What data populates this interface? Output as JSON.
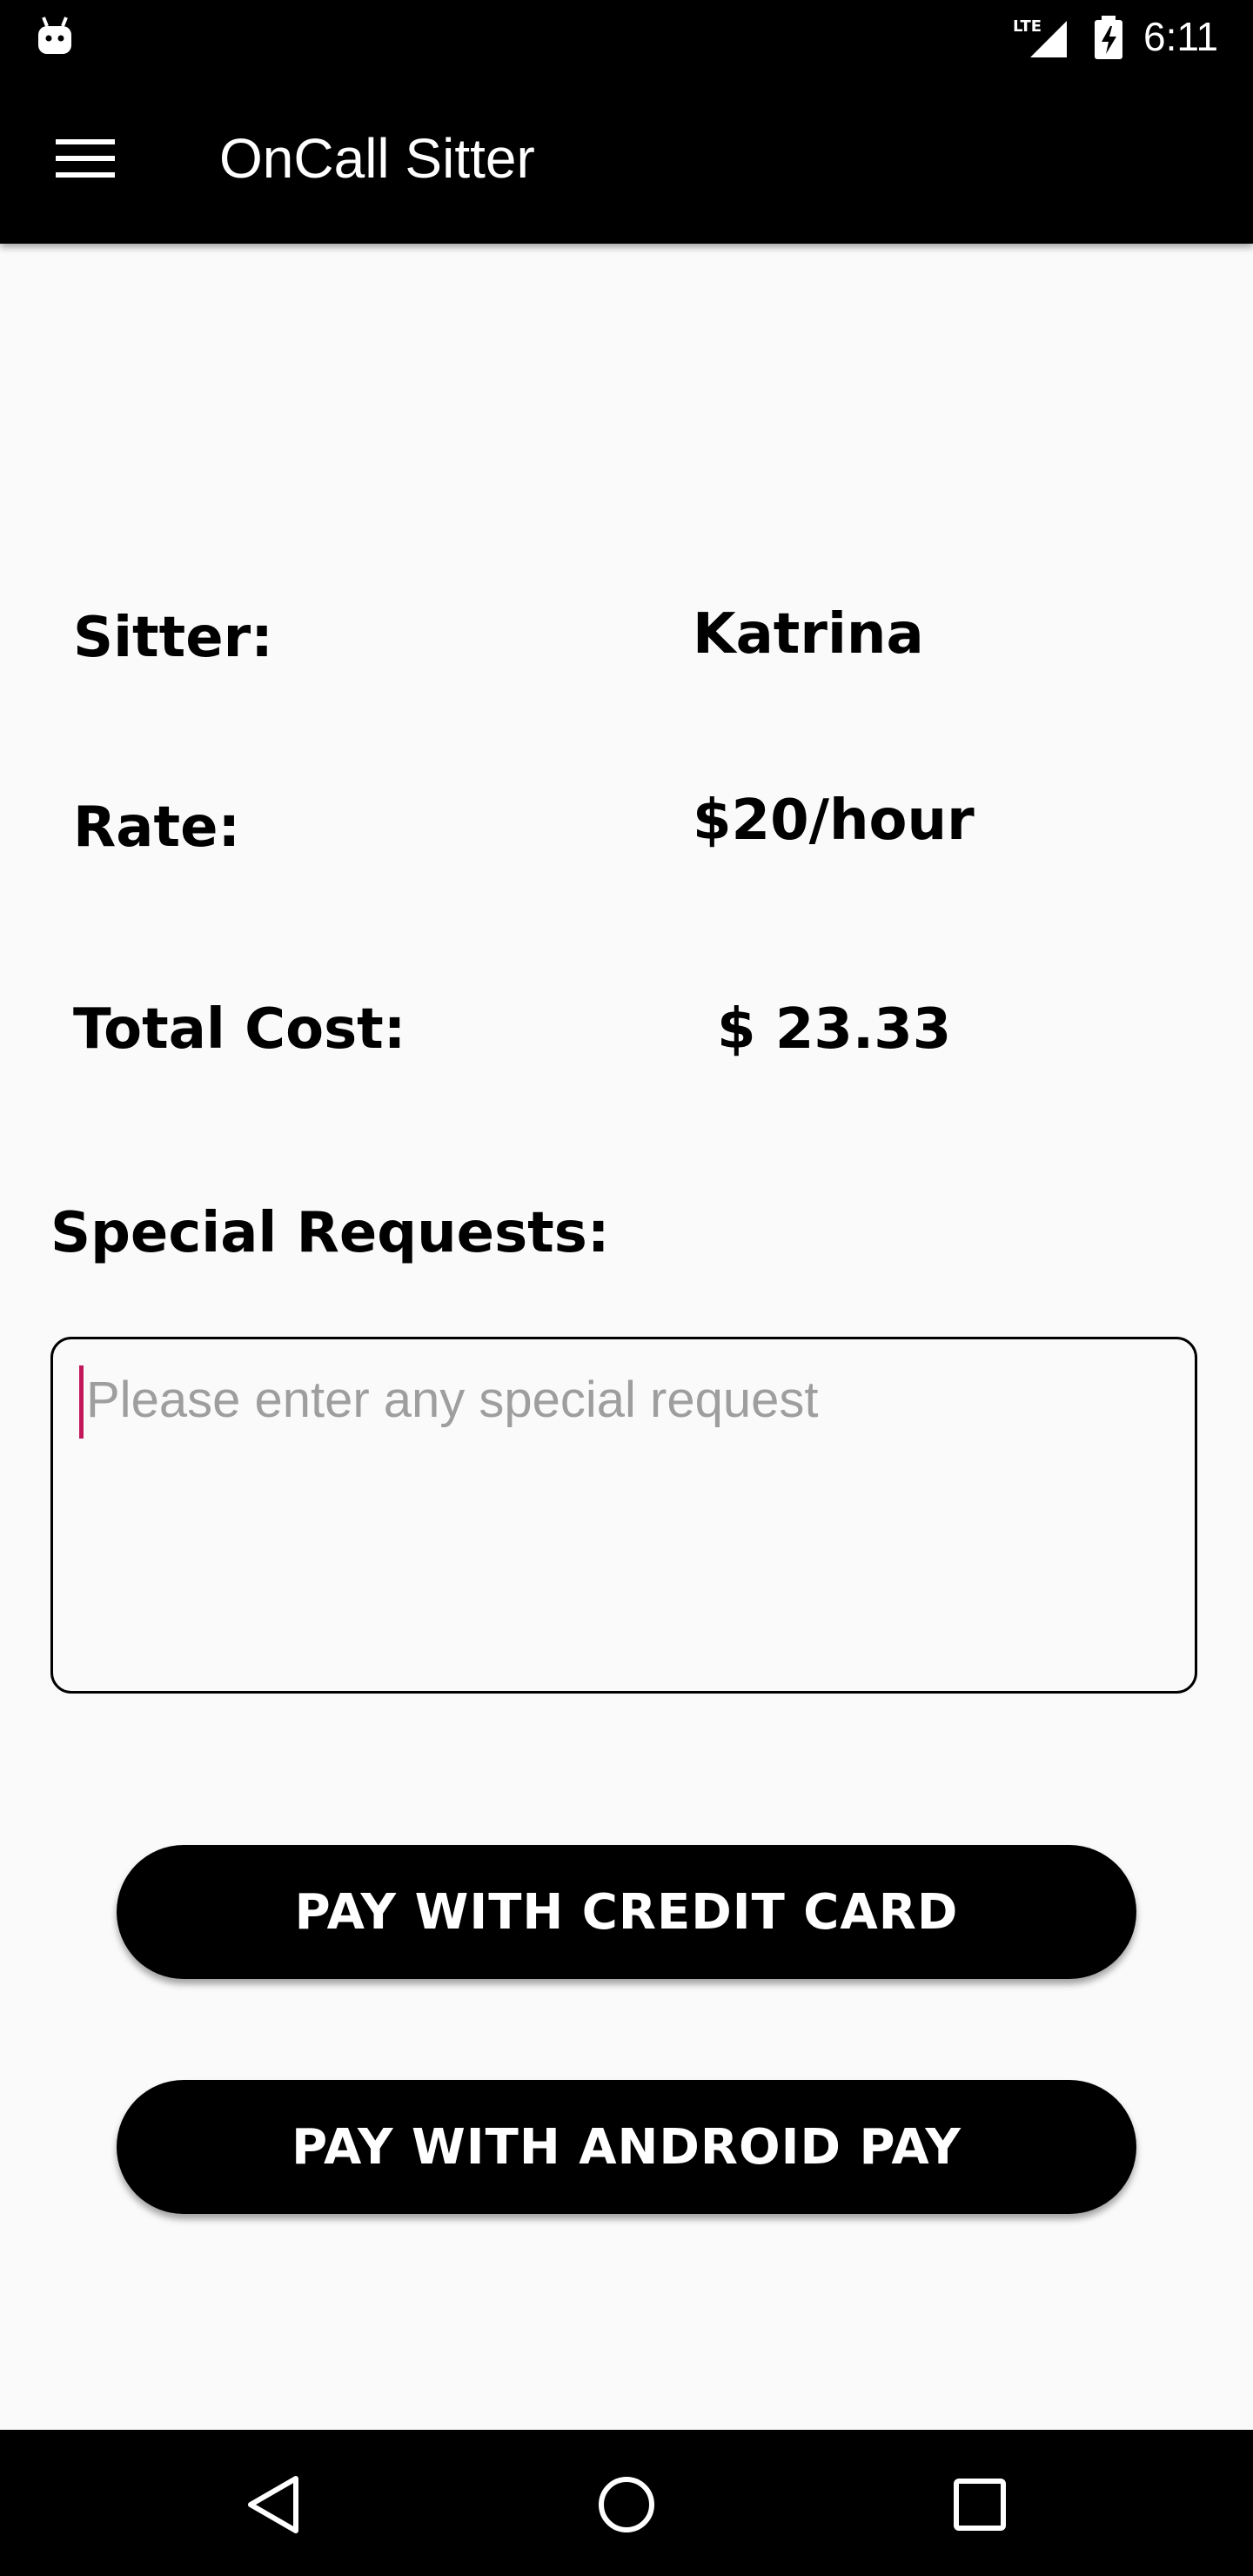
{
  "status_bar": {
    "time": "6:11",
    "network": "LTE",
    "icons": [
      "android-icon",
      "lte-signal-icon",
      "battery-charging-icon"
    ]
  },
  "app_bar": {
    "title": "OnCall Sitter",
    "menu_icon": "hamburger-menu-icon"
  },
  "details": {
    "sitter_label": "Sitter:",
    "sitter_value": "Katrina",
    "rate_label": "Rate:",
    "rate_value": "$20/hour",
    "total_label": "Total Cost:",
    "total_value": "$ 23.33"
  },
  "special_requests": {
    "label": "Special Requests:",
    "value": "",
    "placeholder": "Please enter any special request"
  },
  "buttons": {
    "credit_card": "PAY WITH CREDIT CARD",
    "android_pay": "PAY WITH ANDROID PAY"
  },
  "nav_bar": {
    "icons": [
      "back-icon",
      "home-icon",
      "recents-icon"
    ]
  },
  "colors": {
    "bar_background": "#000000",
    "page_background": "#fafafa",
    "cursor_accent": "#c2185b",
    "placeholder_text": "#9e9e9e"
  }
}
